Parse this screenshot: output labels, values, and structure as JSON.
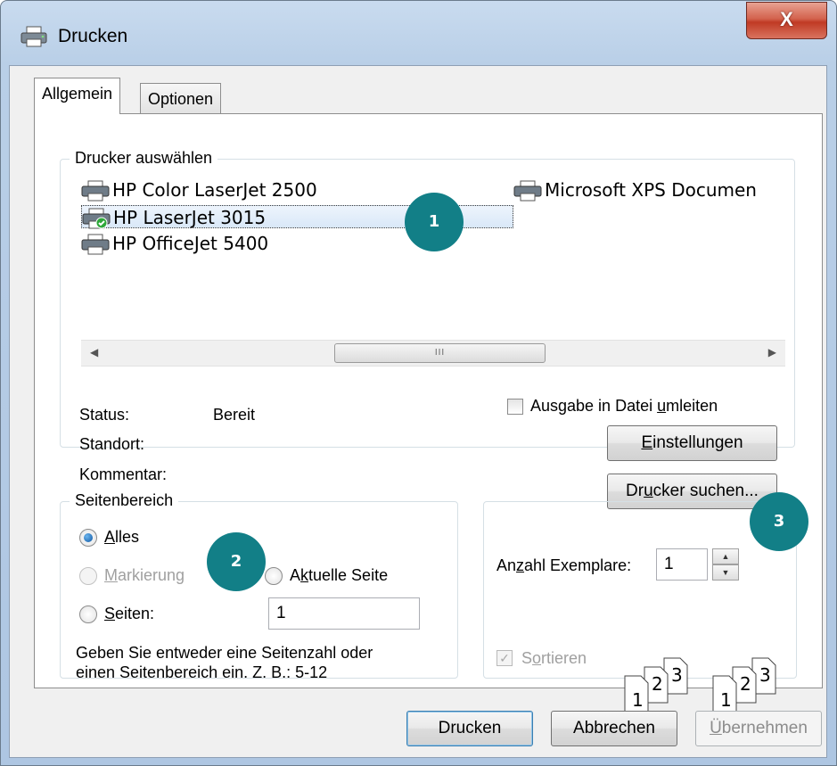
{
  "window": {
    "title": "Drucken",
    "close_label": "X"
  },
  "tabs": [
    {
      "label": "Allgemein",
      "active": true
    },
    {
      "label": "Optionen",
      "active": false
    }
  ],
  "printer_select": {
    "legend": "Drucker auswählen",
    "printers": [
      {
        "name": "HP Color LaserJet 2500",
        "selected": false,
        "is_default": false
      },
      {
        "name": "HP LaserJet 3015",
        "selected": true,
        "is_default": true
      },
      {
        "name": "HP OfficeJet 5400",
        "selected": false,
        "is_default": false
      },
      {
        "name": "Microsoft XPS Documen",
        "selected": false,
        "is_default": false
      }
    ],
    "scroll_grip": "III",
    "status_label": "Status:",
    "status_value": "Bereit",
    "location_label": "Standort:",
    "comment_label": "Kommentar:",
    "print_to_file": {
      "before": "Ausgabe in Datei ",
      "underline": "u",
      "after": "mleiten",
      "checked": false
    },
    "settings_button": {
      "underline": "E",
      "after": "instellungen"
    },
    "find_printer_button": {
      "before": "Dr",
      "underline": "u",
      "after": "cker suchen..."
    }
  },
  "page_range": {
    "legend": "Seitenbereich",
    "all": {
      "underline": "A",
      "after": "lles",
      "checked": true
    },
    "selection": {
      "underline": "M",
      "after": "arkierung",
      "disabled": true
    },
    "current_page": {
      "before": "A",
      "underline": "k",
      "after": "tuelle Seite"
    },
    "pages": {
      "underline": "S",
      "after": "eiten:",
      "value": "1"
    },
    "hint_line1": "Geben Sie entweder eine Seitenzahl oder",
    "hint_line2": "einen Seitenbereich ein. Z. B.: 5-12"
  },
  "copies": {
    "label_before": "An",
    "label_underline": "z",
    "label_after": "ahl Exemplare:",
    "value": "1",
    "collate": {
      "underline": "o",
      "before": "S",
      "after": "rtieren",
      "checked": true,
      "disabled": true
    },
    "collate_icon_pages": [
      "1",
      "2",
      "3"
    ]
  },
  "buttons": {
    "print": "Drucken",
    "cancel": "Abbrechen",
    "apply": {
      "underline": "Ü",
      "after": "bernehmen"
    }
  },
  "callouts": [
    "1",
    "2",
    "3"
  ],
  "colors": {
    "callout": "#127f87",
    "title_gradient_top": "#c9dbef",
    "close_button": "#c03a24",
    "selection": "#d9e8f8"
  }
}
